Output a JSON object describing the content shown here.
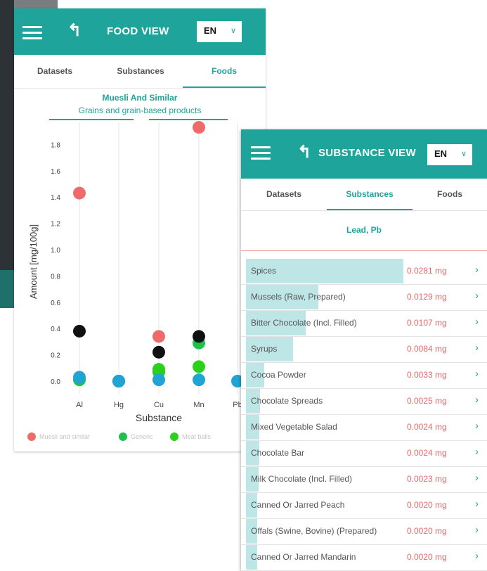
{
  "food_view": {
    "title": "FOOD VIEW",
    "language": "EN",
    "tabs": [
      "Datasets",
      "Substances",
      "Foods"
    ],
    "active_tab": "Foods",
    "food_name": "Muesli And Similar",
    "food_group": "Grains and grain-based products"
  },
  "substance_view": {
    "title": "SUBSTANCE VIEW",
    "language": "EN",
    "tabs": [
      "Datasets",
      "Substances",
      "Foods"
    ],
    "active_tab": "Substances",
    "substance_name": "Lead, Pb",
    "items": [
      {
        "name": "Spices",
        "amount": "0.0281 mg",
        "value": 0.0281
      },
      {
        "name": "Mussels (Raw, Prepared)",
        "amount": "0.0129 mg",
        "value": 0.0129
      },
      {
        "name": "Bitter Chocolate (Incl. Filled)",
        "amount": "0.0107 mg",
        "value": 0.0107
      },
      {
        "name": "Syrups",
        "amount": "0.0084 mg",
        "value": 0.0084
      },
      {
        "name": "Cocoa Powder",
        "amount": "0.0033 mg",
        "value": 0.0033
      },
      {
        "name": "Chocolate Spreads",
        "amount": "0.0025 mg",
        "value": 0.0025
      },
      {
        "name": "Mixed Vegetable Salad",
        "amount": "0.0024 mg",
        "value": 0.0024
      },
      {
        "name": "Chocolate Bar",
        "amount": "0.0024 mg",
        "value": 0.0024
      },
      {
        "name": "Milk Chocolate (Incl. Filled)",
        "amount": "0.0023 mg",
        "value": 0.0023
      },
      {
        "name": "Canned Or Jarred Peach",
        "amount": "0.0020 mg",
        "value": 0.002
      },
      {
        "name": "Offals (Swine, Bovine) (Prepared)",
        "amount": "0.0020 mg",
        "value": 0.002
      },
      {
        "name": "Canned Or Jarred Mandarin",
        "amount": "0.0020 mg",
        "value": 0.002
      }
    ]
  },
  "chart_data": {
    "type": "scatter",
    "xlabel": "Substance",
    "ylabel": "Amount [mg/100g]",
    "categories": [
      "Al",
      "Hg",
      "Cu",
      "Mn",
      "Pb"
    ],
    "ylim": [
      -0.1,
      2.0
    ],
    "yticks": [
      0.0,
      0.2,
      0.4,
      0.6,
      0.8,
      1.0,
      1.2,
      1.4,
      1.6,
      1.8
    ],
    "grid": "vertical",
    "legend_position": "bottom",
    "series": [
      {
        "name": "Muesli and similar",
        "color": "#ef6b6b",
        "values": [
          1.43,
          null,
          0.34,
          1.93,
          null
        ]
      },
      {
        "name": "Generic",
        "color": "#1cc24a",
        "values": [
          0.01,
          null,
          0.07,
          0.29,
          null
        ]
      },
      {
        "name": "Meat balls",
        "color": "#2ad01a",
        "values": [
          null,
          null,
          0.09,
          0.11,
          null
        ]
      },
      {
        "name": "",
        "color": "#111111",
        "values": [
          0.38,
          0.0,
          0.22,
          0.34,
          null
        ]
      },
      {
        "name": "",
        "color": "#1fa4d4",
        "values": [
          0.03,
          0.0,
          0.01,
          0.01,
          0.0
        ]
      }
    ]
  },
  "colors": {
    "accent": "#1fa49b",
    "amount_text": "#e46a6a",
    "bar_fill": "#bfe6e6"
  }
}
